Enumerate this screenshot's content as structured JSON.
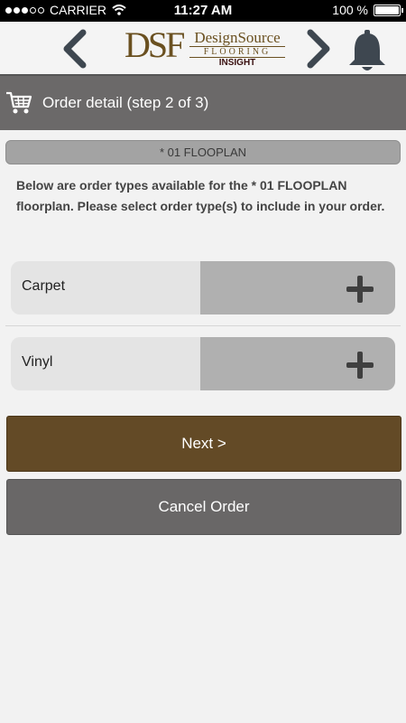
{
  "status": {
    "carrier": "CARRIER",
    "time": "11:27 AM",
    "battery": "100 %",
    "battery_level": 1.0
  },
  "header": {
    "logo_mark": "DSF",
    "logo_line1": "DesignSource",
    "logo_line2": "FLOORING",
    "logo_line3": "INSIGHT"
  },
  "title_bar": {
    "title": "Order detail (step 2 of 3)"
  },
  "floorplan": {
    "name": "* 01 FLOOPLAN"
  },
  "info_text": "Below are order types available for the * 01 FLOOPLAN floorplan. Please select order type(s) to include in your order.",
  "order_types": [
    {
      "label": "Carpet"
    },
    {
      "label": "Vinyl"
    }
  ],
  "buttons": {
    "next": "Next >",
    "cancel": "Cancel Order"
  },
  "colors": {
    "brand_brown": "#634a26",
    "title_bar": "#6b6969",
    "cancel": "#696767"
  }
}
